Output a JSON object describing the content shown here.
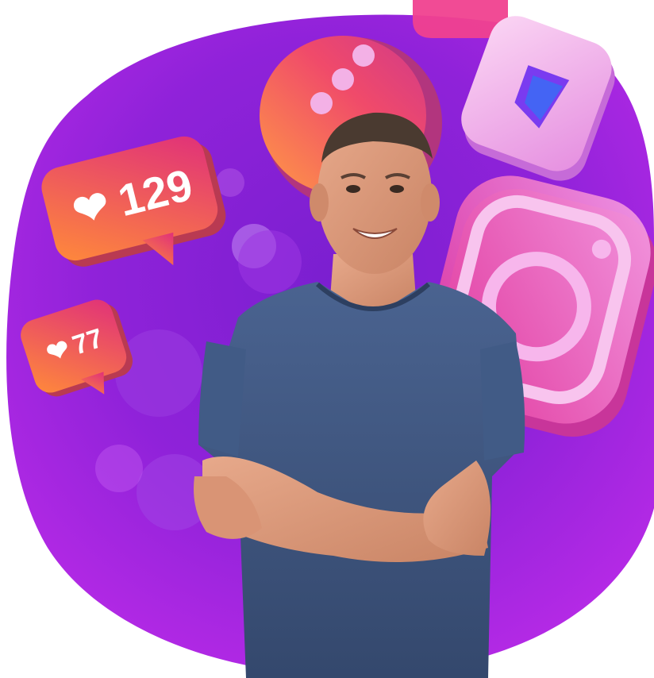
{
  "badges": {
    "primary": {
      "icon": "heart-icon",
      "count": "129"
    },
    "secondary": {
      "icon": "heart-icon",
      "count": "77"
    }
  },
  "icons": {
    "chat": "chat-bubble-icon",
    "reels": "reels-icon",
    "instagram": "instagram-logo-icon"
  },
  "colors": {
    "background_purple": "#a21fd6",
    "deep_purple": "#5b17a8",
    "badge_orange": "#ff6b3d",
    "badge_pink": "#e0307a",
    "shirt_blue": "#3f5a82"
  }
}
